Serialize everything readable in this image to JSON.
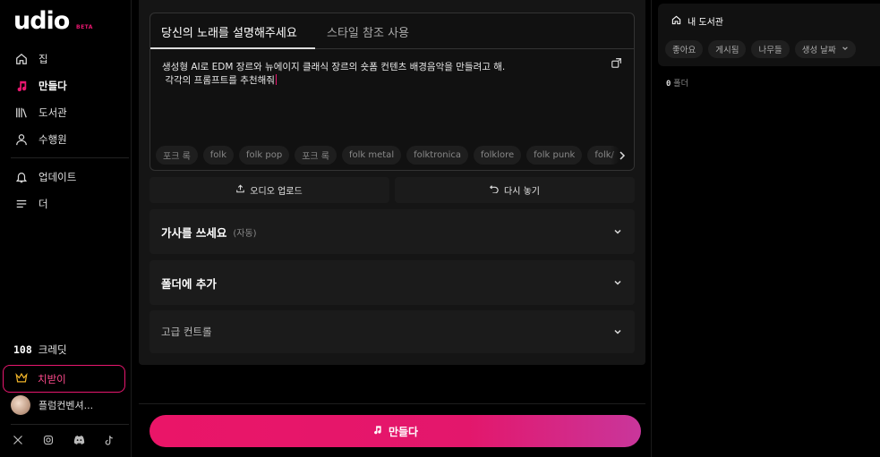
{
  "logo": {
    "text": "udio",
    "badge": "BETA"
  },
  "nav": {
    "home": "집",
    "create": "만들다",
    "library": "도서관",
    "achievements": "수행원",
    "updates": "업데이트",
    "more": "더"
  },
  "credits": {
    "count": "108",
    "label": "크레딧"
  },
  "upgrade_label": "치받이",
  "user_name": "플럼컨벤셔...",
  "prompt": {
    "tab_describe": "당신의 노래를 설명해주세요",
    "tab_style": "스타일 참조 사용",
    "text": "생성형 AI로 EDM 장르와 뉴에이지 클래식 장르의 숏폼 컨텐츠 배경음악을 만들려고 해.\n 각각의 프롬프트를 추천해줘",
    "tags": [
      "포크 록",
      "folk",
      "folk pop",
      "포크 록",
      "folk metal",
      "folktronica",
      "folklore",
      "folk punk",
      "folk/"
    ]
  },
  "buttons": {
    "upload": "오디오 업로드",
    "reset": "다시 놓기"
  },
  "sections": {
    "lyrics_title": "가사를 쓰세요",
    "lyrics_sub": "(자동)",
    "folder_title": "폴더에 추가",
    "advanced_title": "고급 컨트롤"
  },
  "create_button": "만들다",
  "library_panel": {
    "title": "내 도서관",
    "filters": [
      "좋아요",
      "게시됨",
      "나무들",
      "생성 날짜"
    ],
    "folder_count": "0",
    "folder_label": "폴더"
  },
  "colors": {
    "accent": "#e8176f",
    "background": "#000000",
    "panel": "#151515"
  },
  "icons": [
    "home-icon",
    "music-note-icon",
    "library-icon",
    "user-icon",
    "bell-icon",
    "menu-icon",
    "crown-icon",
    "x-icon",
    "instagram-icon",
    "discord-icon",
    "tiktok-icon",
    "copy-icon",
    "upload-icon",
    "undo-icon",
    "chevron-down-icon",
    "chevron-right-icon"
  ]
}
